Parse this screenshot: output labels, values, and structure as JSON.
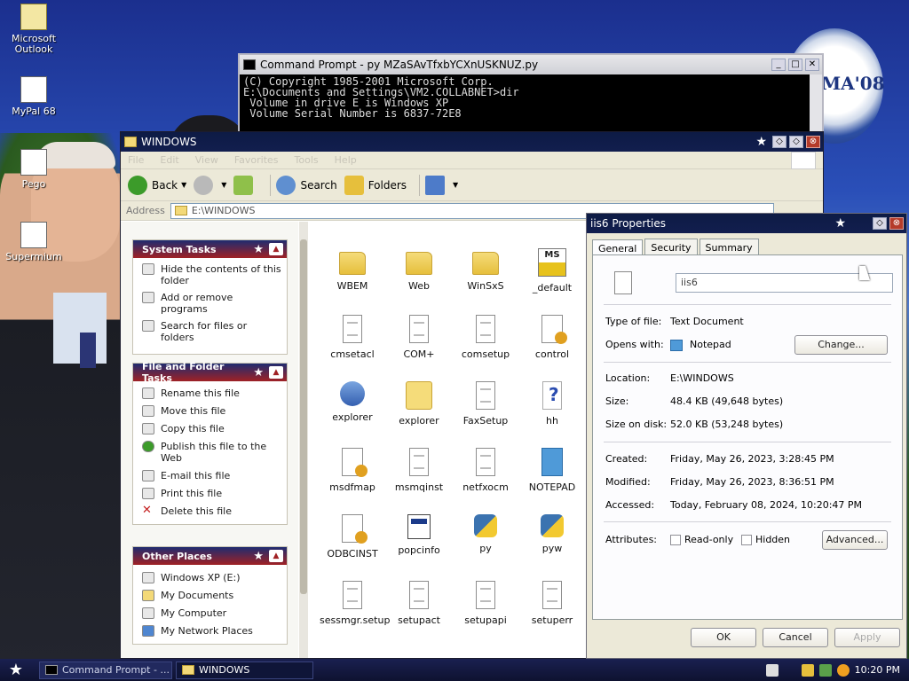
{
  "desktop": {
    "icons": [
      {
        "label": "Microsoft Outlook"
      },
      {
        "label": "MyPal 68"
      },
      {
        "label": "Pego"
      },
      {
        "label": "Supermium"
      }
    ],
    "background_logo_text": "MA'08"
  },
  "cmd": {
    "title": "Command Prompt - py MZaSAvTfxbYCXnUSKNUZ.py",
    "lines": [
      "(C) Copyright 1985-2001 Microsoft Corp.",
      "",
      "E:\\Documents and Settings\\VM2.COLLABNET>dir",
      " Volume in drive E is Windows XP",
      " Volume Serial Number is 6837-72E8"
    ]
  },
  "explorer": {
    "title": "WINDOWS",
    "menu": [
      "File",
      "Edit",
      "View",
      "Favorites",
      "Tools",
      "Help"
    ],
    "toolbar": {
      "back": "Back",
      "search": "Search",
      "folders": "Folders"
    },
    "address_label": "Address",
    "address_value": "E:\\WINDOWS",
    "system_tasks": {
      "title": "System Tasks",
      "items": [
        "Hide the contents of this folder",
        "Add or remove programs",
        "Search for files or folders"
      ]
    },
    "file_tasks": {
      "title": "File and Folder Tasks",
      "items": [
        "Rename this file",
        "Move this file",
        "Copy this file",
        "Publish this file to the Web",
        "E-mail this file",
        "Print this file",
        "Delete this file"
      ]
    },
    "other_places": {
      "title": "Other Places",
      "items": [
        "Windows XP (E:)",
        "My Documents",
        "My Computer",
        "My Network Places"
      ]
    },
    "files": [
      {
        "name": "WBEM",
        "icon": "folder-icon"
      },
      {
        "name": "Web",
        "icon": "folder-icon"
      },
      {
        "name": "WinSxS",
        "icon": "folder-icon"
      },
      {
        "name": "_default",
        "icon": "ms-icon"
      },
      {
        "name": "cmsetacl",
        "icon": "document-icon"
      },
      {
        "name": "COM+",
        "icon": "document-icon"
      },
      {
        "name": "comsetup",
        "icon": "document-icon"
      },
      {
        "name": "control",
        "icon": "config-icon"
      },
      {
        "name": "explorer",
        "icon": "app-icon"
      },
      {
        "name": "explorer",
        "icon": "search-folder-icon"
      },
      {
        "name": "FaxSetup",
        "icon": "document-icon"
      },
      {
        "name": "hh",
        "icon": "help-icon"
      },
      {
        "name": "msdfmap",
        "icon": "config-icon"
      },
      {
        "name": "msmqinst",
        "icon": "document-icon"
      },
      {
        "name": "netfxocm",
        "icon": "document-icon"
      },
      {
        "name": "NOTEPAD",
        "icon": "notepad-icon"
      },
      {
        "name": "ODBCINST",
        "icon": "config-icon"
      },
      {
        "name": "popcinfo",
        "icon": "executable-icon"
      },
      {
        "name": "py",
        "icon": "python-icon"
      },
      {
        "name": "pyw",
        "icon": "python-icon"
      },
      {
        "name": "sessmgr.setup",
        "icon": "document-icon"
      },
      {
        "name": "setupact",
        "icon": "document-icon"
      },
      {
        "name": "setupapi",
        "icon": "document-icon"
      },
      {
        "name": "setuperr",
        "icon": "document-icon"
      }
    ],
    "ms_icon_text": "MS"
  },
  "props": {
    "title": "iis6 Properties",
    "tabs": [
      "General",
      "Security",
      "Summary"
    ],
    "name": "iis6",
    "type_label": "Type of file:",
    "type_value": "Text Document",
    "opens_label": "Opens with:",
    "opens_value": "Notepad",
    "change_btn": "Change...",
    "location_label": "Location:",
    "location_value": "E:\\WINDOWS",
    "size_label": "Size:",
    "size_value": "48.4 KB (49,648 bytes)",
    "size_disk_label": "Size on disk:",
    "size_disk_value": "52.0 KB (53,248 bytes)",
    "created_label": "Created:",
    "created_value": "Friday, May 26, 2023, 3:28:45 PM",
    "modified_label": "Modified:",
    "modified_value": "Friday, May 26, 2023, 8:36:51 PM",
    "accessed_label": "Accessed:",
    "accessed_value": "Today, February 08, 2024, 10:20:47 PM",
    "attributes_label": "Attributes:",
    "readonly_label": "Read-only",
    "hidden_label": "Hidden",
    "advanced_btn": "Advanced...",
    "ok_btn": "OK",
    "cancel_btn": "Cancel",
    "apply_btn": "Apply"
  },
  "taskbar": {
    "buttons": [
      "Command Prompt - ...",
      "WINDOWS"
    ],
    "clock": "10:20 PM"
  }
}
